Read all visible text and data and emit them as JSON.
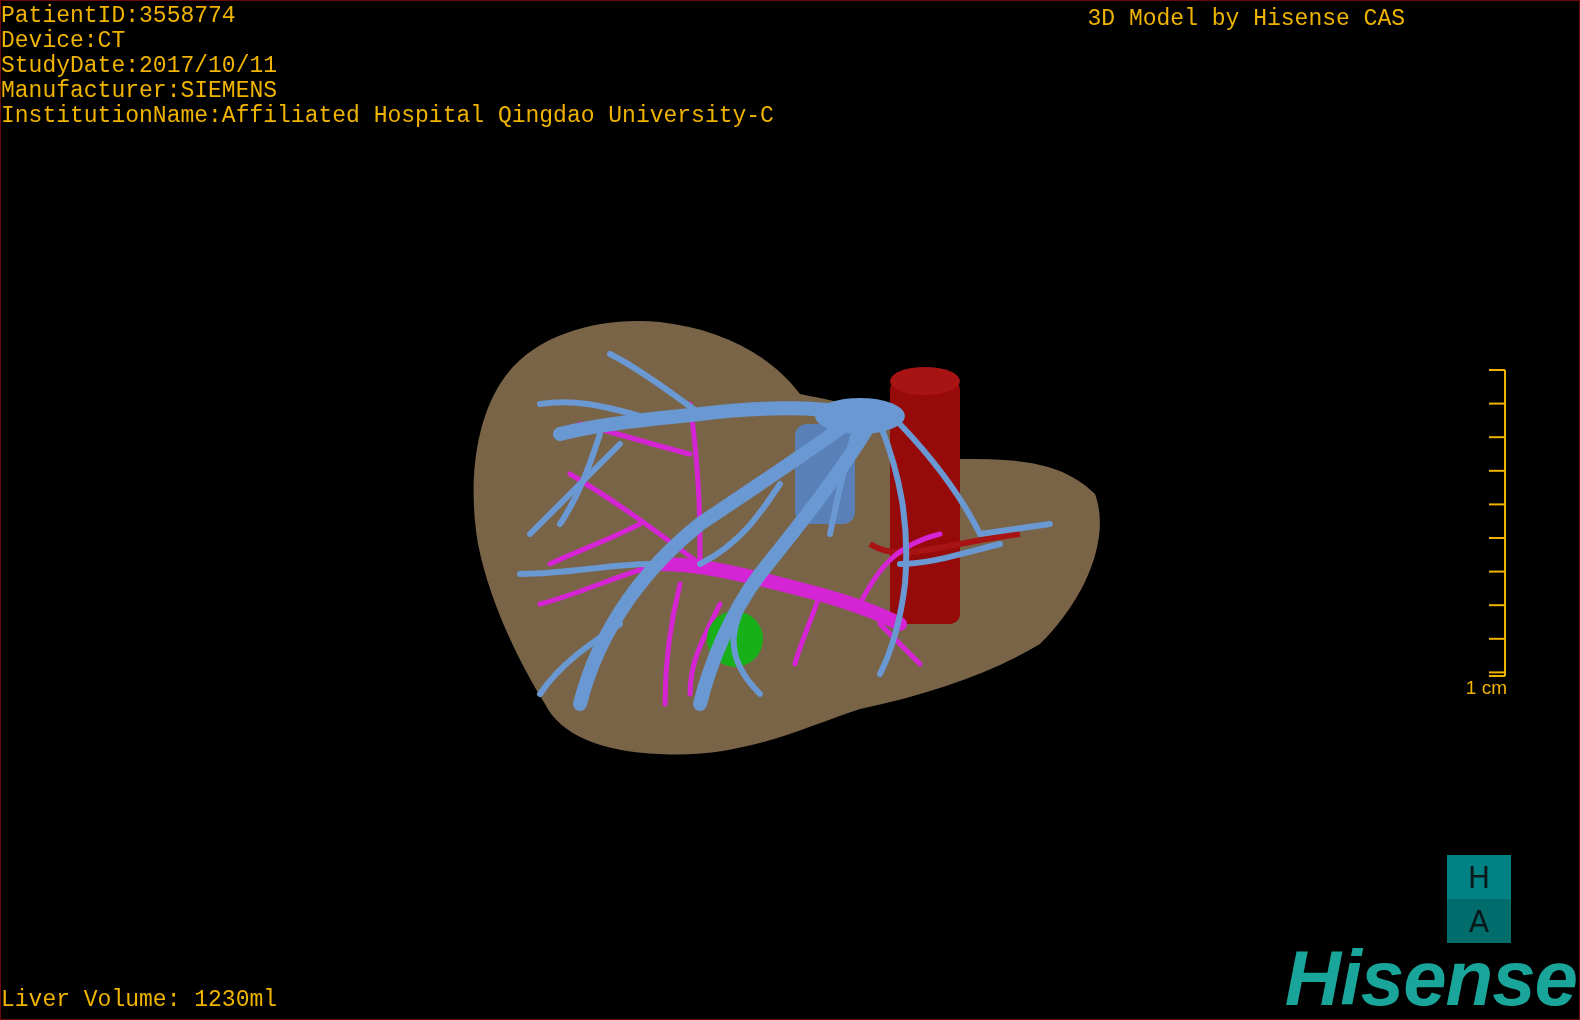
{
  "info_lines": [
    "PatientID:3558774",
    "Device:CT",
    "StudyDate:2017/10/11",
    "Manufacturer:SIEMENS",
    "InstitutionName:Affiliated Hospital Qingdao University-C"
  ],
  "title": "3D Model by Hisense CAS",
  "scale_bar": {
    "label": "1 cm"
  },
  "liver_volume": "Liver Volume: 1230ml",
  "logo": {
    "badge_letters": [
      "H",
      "A"
    ],
    "wordmark": "Hisense"
  }
}
